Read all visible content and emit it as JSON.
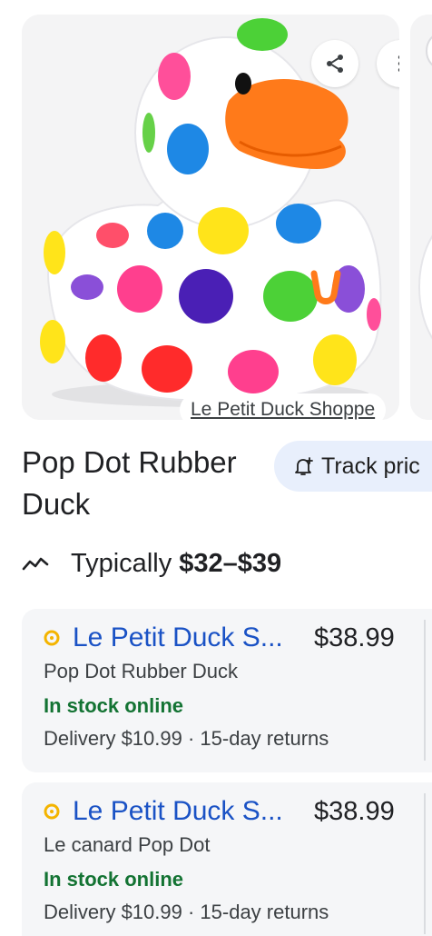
{
  "product": {
    "image_source": "Le Petit Duck Shoppe",
    "title": "Pop Dot Rubber Duck",
    "track_label": "Track pric"
  },
  "typical": {
    "label": "Typically",
    "range": "$32–$39"
  },
  "offers": [
    {
      "merchant": "Le Petit Duck S...",
      "price": "$38.99",
      "product_name": "Pop Dot Rubber Duck",
      "stock": "In stock online",
      "delivery": "Delivery $10.99 · 15-day returns"
    },
    {
      "merchant": "Le Petit Duck S...",
      "price": "$38.99",
      "product_name": "Le canard Pop Dot",
      "stock": "In stock online",
      "delivery": "Delivery $10.99 · 15-day returns"
    }
  ],
  "icons": {
    "share": "share-icon",
    "more": "more-vert-icon",
    "bell": "bell-plus-icon",
    "trend": "trend-line-icon",
    "merchant": "merchant-dot-icon"
  },
  "colors": {
    "link_blue": "#1a52c5",
    "stock_green": "#137333",
    "track_bg": "#e8effc",
    "card_bg": "#f5f6f8",
    "merchant_dot": "#f4b400"
  }
}
